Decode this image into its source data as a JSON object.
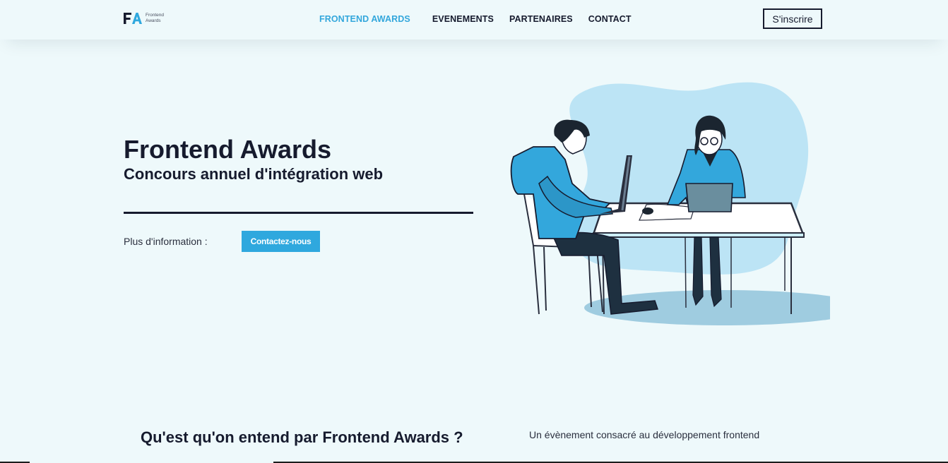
{
  "logo": {
    "line1": "Frontend",
    "line2": "Awards"
  },
  "nav": {
    "items": [
      {
        "label": "FRONTEND AWARDS"
      },
      {
        "label": "EVENEMENTS"
      },
      {
        "label": "PARTENAIRES"
      },
      {
        "label": "CONTACT"
      }
    ],
    "signup_label": "S'inscrire"
  },
  "hero": {
    "title": "Frontend Awards",
    "subtitle": "Concours annuel d'intégration web",
    "info_label": "Plus d'information :",
    "contact_button": "Contactez-nous"
  },
  "about": {
    "title": "Qu'est qu'on entend par Frontend Awards ?",
    "text": "Un évènement consacré au développement frontend"
  },
  "colors": {
    "accent": "#33a7dc",
    "dark": "#161b2e",
    "background": "#eef9fb",
    "blob": "#bce4f5"
  }
}
